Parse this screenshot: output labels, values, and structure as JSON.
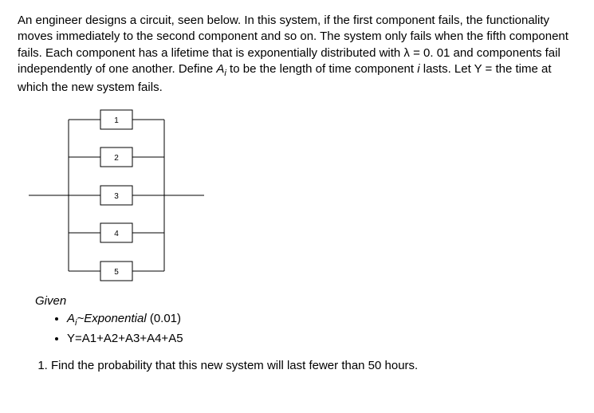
{
  "problem": {
    "p1a": "An engineer designs a circuit, seen below. In this system, if the first component fails, the functionality moves immediately to the second component and so on. The system only fails when the fifth component fails. Each component has a lifetime that is exponentially distributed with λ = 0. 01 and components fail independently of one another. Define ",
    "p1b": "A",
    "p1c": "i",
    "p1d": " to be the length of time component ",
    "p1e": "i",
    "p1f": " lasts. Let Y = the time at which the new system fails."
  },
  "circuit": {
    "labels": [
      "1",
      "2",
      "3",
      "4",
      "5"
    ]
  },
  "given": {
    "title": "Given",
    "b1a": "A",
    "b1b": "i",
    "b1c": "~Exponential",
    "b1d": " (0.01)",
    "b2": "Y=A1+A2+A3+A4+A5"
  },
  "question": {
    "q1": "Find the probability that this new system will last fewer than 50 hours."
  }
}
